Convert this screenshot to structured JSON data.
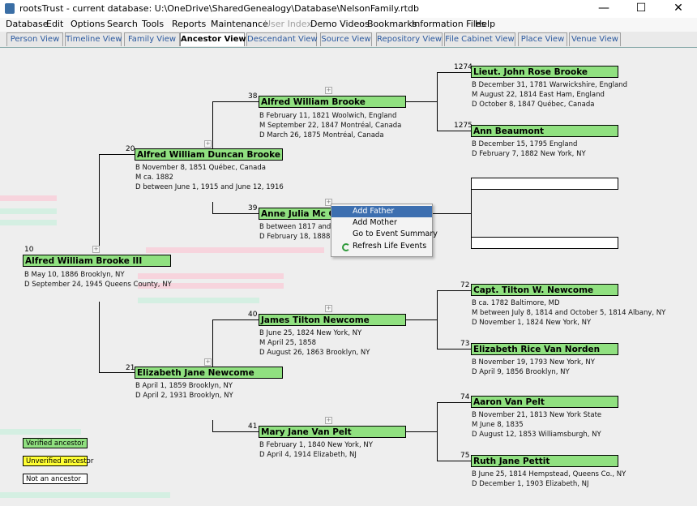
{
  "window": {
    "title": "rootsTrust - current database: U:\\OneDrive\\SharedGenealogy\\Database\\NelsonFamily.rtdb",
    "minimize": "—",
    "maximize": "☐",
    "close": "✕"
  },
  "menu": {
    "items": [
      "Database",
      "Edit",
      "Options",
      "Search",
      "Tools",
      "Reports",
      "Maintenance",
      "User Index",
      "Demo Videos",
      "Bookmarks",
      "Information Files",
      "Help"
    ]
  },
  "tabs": [
    "Person View",
    "Timeline View",
    "Family View",
    "Ancestor View",
    "Descendant View",
    "Source View",
    "Repository View",
    "File Cabinet View",
    "Place View",
    "Venue View"
  ],
  "active_tab": "Ancestor View",
  "colors": {
    "verified": "#90e080",
    "unverified": "#ffff33",
    "not_ancestor": "#ffffff",
    "menu_highlight": "#3d6fb0"
  },
  "people": {
    "p10": {
      "num": "10",
      "name": "Alfred William Brooke III",
      "details": [
        "B May 10, 1886 Brooklyn, NY",
        "D September 24, 1945 Queens County, NY"
      ]
    },
    "p20": {
      "num": "20",
      "name": "Alfred William Duncan Brooke",
      "details": [
        "B November 8, 1851 Québec, Canada",
        "M ca. 1882",
        "D between June 1, 1915 and June 12, 1916"
      ]
    },
    "p21": {
      "num": "21",
      "name": "Elizabeth Jane Newcome",
      "details": [
        "B April 1, 1859 Brooklyn, NY",
        "D April 2, 1931 Brooklyn, NY"
      ]
    },
    "p38": {
      "num": "38",
      "name": "Alfred William Brooke",
      "details": [
        "B February 11, 1821 Woolwich, England",
        "M September 22, 1847 Montréal, Canada",
        "D March 26, 1875 Montréal, Canada"
      ]
    },
    "p39": {
      "num": "39",
      "name": "Anne Julia Mc Cart",
      "details": [
        "B between 1817 and 181",
        "D February 18, 1888 Lon"
      ]
    },
    "p40": {
      "num": "40",
      "name": "James Tilton Newcome",
      "details": [
        "B June 25, 1824 New York, NY",
        "M April 25, 1858",
        "D August 26, 1863 Brooklyn, NY"
      ]
    },
    "p41": {
      "num": "41",
      "name": "Mary Jane Van Pelt",
      "details": [
        "B February 1, 1840 New York, NY",
        "D April 4, 1914 Elizabeth, NJ"
      ]
    },
    "p1274": {
      "num": "1274",
      "name": "Lieut. John Rose Brooke",
      "details": [
        "B December 31, 1781 Warwickshire, England",
        "M August 22, 1814 East Ham, England",
        "D October 8, 1847 Québec, Canada"
      ]
    },
    "p1275": {
      "num": "1275",
      "name": "Ann Beaumont",
      "details": [
        "B December 15, 1795 England",
        "D February 7, 1882 New York, NY"
      ]
    },
    "p72": {
      "num": "72",
      "name": "Capt. Tilton W. Newcome",
      "details": [
        "B ca. 1782 Baltimore, MD",
        "M between July 8, 1814 and October 5, 1814 Albany, NY",
        "D November 1, 1824 New York, NY"
      ]
    },
    "p73": {
      "num": "73",
      "name": "Elizabeth Rice Van Norden",
      "details": [
        "B November 19, 1793 New York, NY",
        "D April 9, 1856 Brooklyn, NY"
      ]
    },
    "p74": {
      "num": "74",
      "name": "Aaron Van Pelt",
      "details": [
        "B November 21, 1813 New York State",
        "M June 8, 1835",
        "D August 12, 1853 Williamsburgh, NY"
      ]
    },
    "p75": {
      "num": "75",
      "name": "Ruth Jane Pettit",
      "details": [
        "B June 25, 1814 Hempstead, Queens Co., NY",
        "D December 1, 1903 Elizabeth, NJ"
      ]
    }
  },
  "context_menu": {
    "items": [
      "Add Father",
      "Add Mother",
      "Go to Event Summary",
      "Refresh Life Events"
    ],
    "highlighted": "Add Father"
  },
  "legend": {
    "verified": "Verified ancestor",
    "unverified": "Unverified ancestor",
    "not_ancestor": "Not an ancestor"
  }
}
